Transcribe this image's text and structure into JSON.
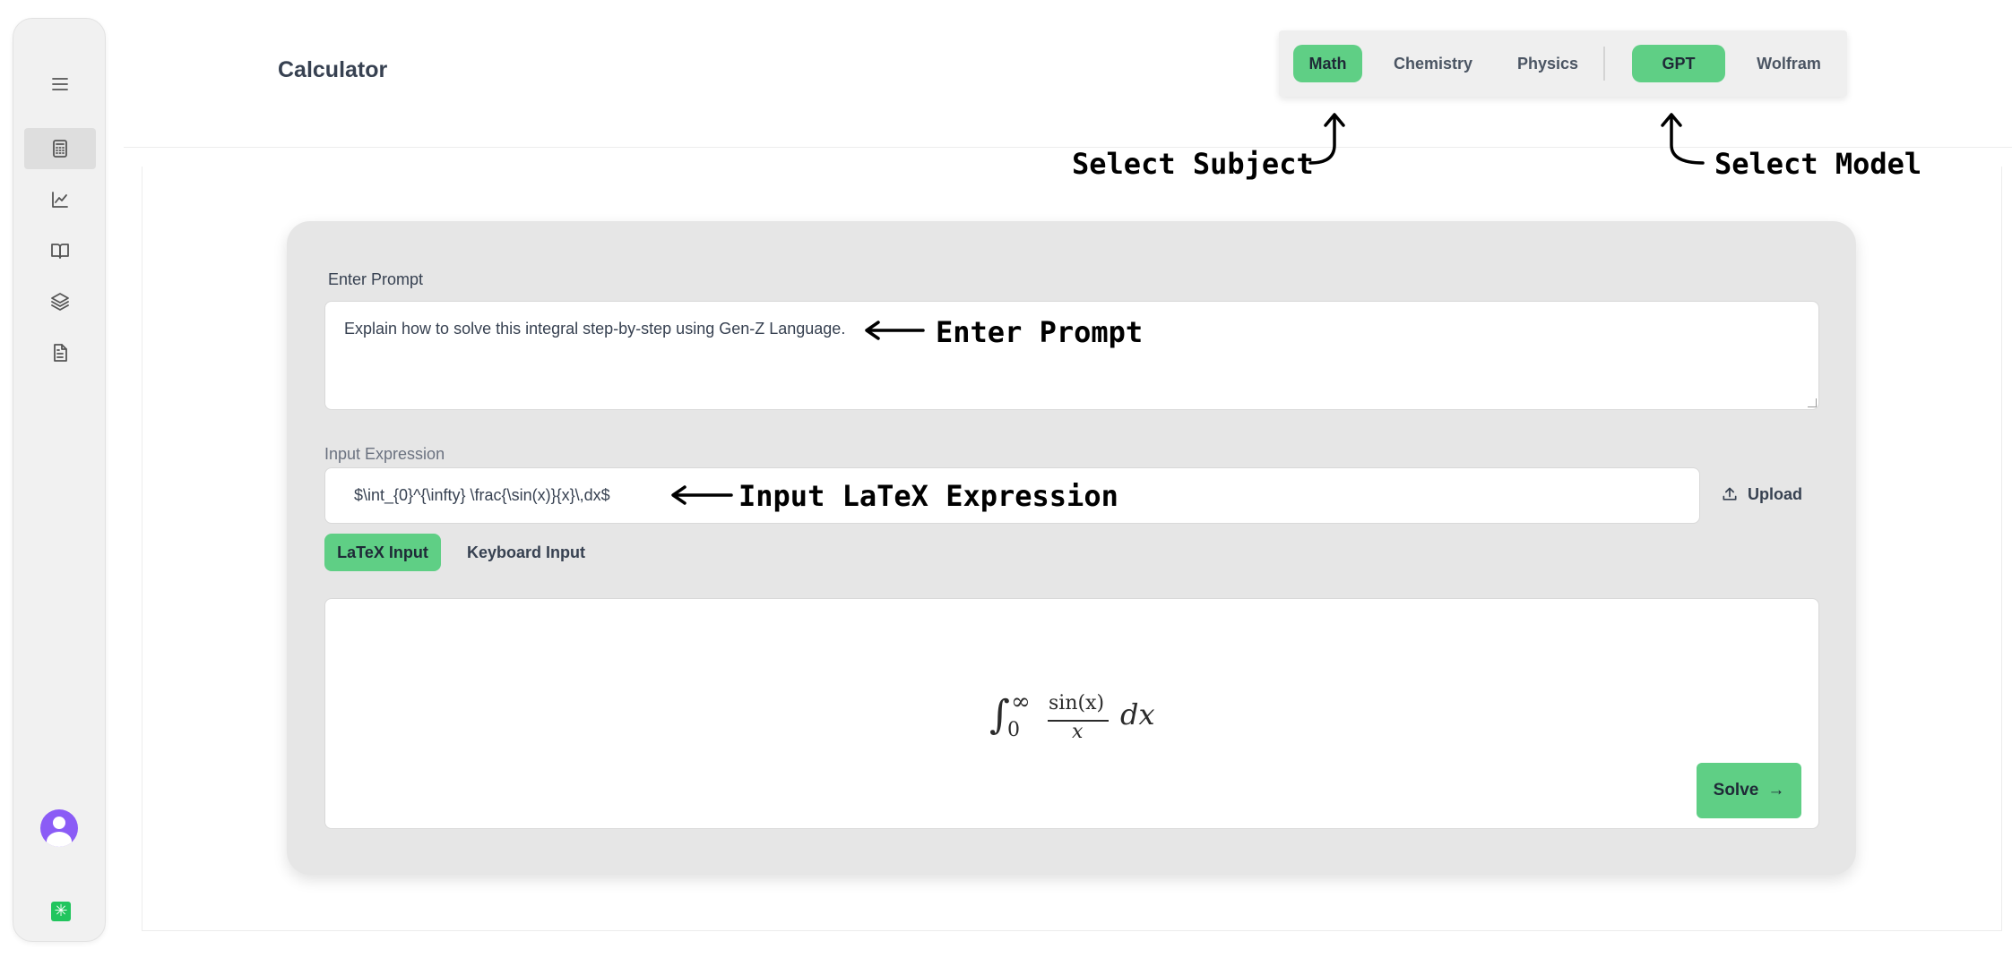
{
  "app": {
    "title": "Calculator"
  },
  "sidebar": {
    "menu_icon": "hamburger-icon",
    "items": [
      {
        "name": "calculator",
        "icon": "calculator-icon",
        "active": true
      },
      {
        "name": "graph",
        "icon": "chart-line-icon",
        "active": false
      },
      {
        "name": "book",
        "icon": "book-open-icon",
        "active": false
      },
      {
        "name": "layers",
        "icon": "layers-icon",
        "active": false
      },
      {
        "name": "document",
        "icon": "file-text-icon",
        "active": false
      }
    ],
    "avatar_icon": "user-avatar-icon",
    "brand_icon": "sparkle-logo-icon"
  },
  "subjects": {
    "items": [
      "Math",
      "Chemistry",
      "Physics"
    ],
    "selected": "Math"
  },
  "models": {
    "items": [
      "GPT",
      "Wolfram"
    ],
    "selected": "GPT"
  },
  "annotations": {
    "select_subject": "Select Subject",
    "select_model": "Select Model",
    "enter_prompt": "Enter Prompt",
    "input_latex": "Input LaTeX Expression"
  },
  "prompt": {
    "label": "Enter Prompt",
    "value": "Explain how to solve this integral step-by-step using Gen-Z Language."
  },
  "expression": {
    "label": "Input Expression",
    "value": "$\\int_{0}^{\\infty} \\frac{\\sin(x)}{x}\\,dx$",
    "upload_label": "Upload"
  },
  "input_modes": {
    "items": [
      "LaTeX Input",
      "Keyboard Input"
    ],
    "selected": "LaTeX Input"
  },
  "preview": {
    "integral": "∫",
    "lower": "0",
    "upper": "∞",
    "numerator": "sin(x)",
    "denominator": "x",
    "differential": "dx"
  },
  "solve": {
    "label": "Solve",
    "arrow": "→"
  },
  "colors": {
    "accent": "#5fcf85",
    "panel": "#e6e6e6",
    "avatar": "#8b5cf6"
  }
}
